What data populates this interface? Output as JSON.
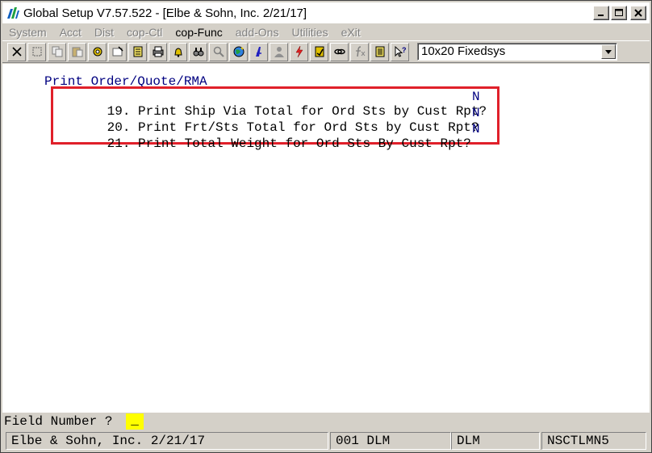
{
  "window": {
    "title": "Global Setup V7.57.522 - [Elbe & Sohn, Inc. 2/21/17]"
  },
  "menu": {
    "items": [
      "System",
      "Acct",
      "Dist",
      "cop-Ctl",
      "cop-Func",
      "add-Ons",
      "Utilities",
      "eXit"
    ],
    "active_index": 4
  },
  "toolbar": {
    "icons": [
      "close-x-icon",
      "select-icon",
      "copy-icon",
      "paste-icon",
      "settings-icon",
      "options-icon",
      "notes-icon",
      "print-icon",
      "bell-icon",
      "binoculars-icon",
      "search-icon",
      "globe-icon",
      "font-icon",
      "user-icon",
      "lightning-icon",
      "calculator-icon",
      "link-icon",
      "function-icon",
      "list-icon",
      "help-pointer-icon"
    ],
    "font_select_value": "10x20 Fixedsys"
  },
  "screen": {
    "section_title": "Print Order/Quote/RMA",
    "options": [
      {
        "number": "19.",
        "label": "Print Ship Via Total for Ord Sts by Cust Rpt?",
        "value": "N"
      },
      {
        "number": "20.",
        "label": "Print Frt/Sts Total for Ord Sts by Cust Rpt?",
        "value": "N"
      },
      {
        "number": "21.",
        "label": "Print Total Weight for Ord Sts By Cust Rpt?",
        "value": "N"
      }
    ]
  },
  "prompt": {
    "label": "Field Number ?",
    "cursor": "_"
  },
  "status": {
    "company": "Elbe & Sohn, Inc. 2/21/17",
    "session": "001 DLM",
    "user": "DLM",
    "program": "NSCTLMN5"
  },
  "colors": {
    "highlight_box": "#e0202a",
    "field_value": "#000080",
    "cursor_bg": "#ffff00"
  }
}
